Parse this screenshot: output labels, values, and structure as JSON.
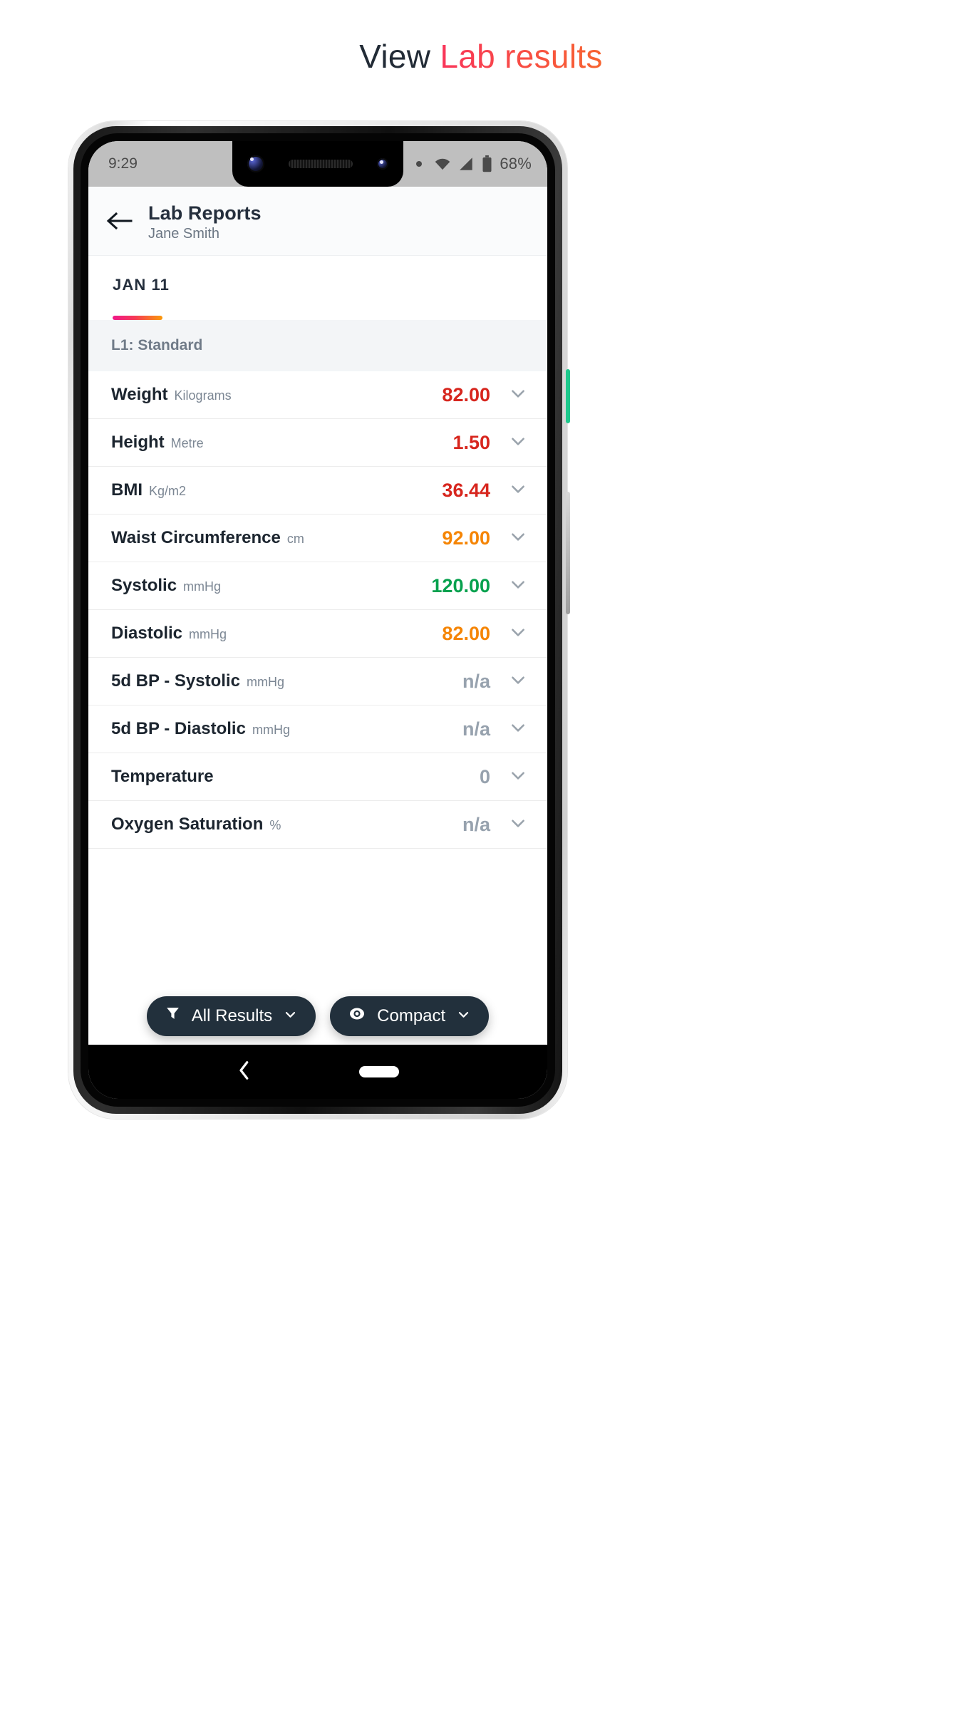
{
  "page": {
    "title_plain": "View ",
    "title_accent": "Lab results",
    "accent_from": "#f9355a",
    "accent_to": "#f7642f"
  },
  "status_bar": {
    "time": "9:29",
    "battery": "68%",
    "icons": [
      "dot-indicator-icon",
      "wifi-icon",
      "cell-signal-icon",
      "battery-icon"
    ]
  },
  "app_bar": {
    "back_icon": "back-arrow-icon",
    "title": "Lab Reports",
    "subtitle": "Jane Smith"
  },
  "tabs": [
    {
      "label": "JAN 11",
      "selected": true
    }
  ],
  "section": {
    "header": "L1: Standard"
  },
  "rows": [
    {
      "name": "Weight",
      "unit": "Kilograms",
      "value": "82.00",
      "color": "#d7261e"
    },
    {
      "name": "Height",
      "unit": "Metre",
      "value": "1.50",
      "color": "#d7261e"
    },
    {
      "name": "BMI",
      "unit": "Kg/m2",
      "value": "36.44",
      "color": "#d7261e"
    },
    {
      "name": "Waist Circumference",
      "unit": "cm",
      "value": "92.00",
      "color": "#f58505"
    },
    {
      "name": "Systolic",
      "unit": "mmHg",
      "value": "120.00",
      "color": "#06a14e"
    },
    {
      "name": "Diastolic",
      "unit": "mmHg",
      "value": "82.00",
      "color": "#f58505"
    },
    {
      "name": "5d BP - Systolic",
      "unit": "mmHg",
      "value": "n/a",
      "color": "#97a2ae"
    },
    {
      "name": "5d BP - Diastolic",
      "unit": "mmHg",
      "value": "n/a",
      "color": "#97a2ae"
    },
    {
      "name": "Temperature",
      "unit": "",
      "value": "0",
      "color": "#97a2ae"
    },
    {
      "name": "Oxygen Saturation",
      "unit": "%",
      "value": "n/a",
      "color": "#97a2ae"
    }
  ],
  "fabs": [
    {
      "icon": "filter-funnel-icon",
      "label": "All Results",
      "chevron": "chevron-down-icon"
    },
    {
      "icon": "eye-icon",
      "label": "Compact",
      "chevron": "chevron-down-icon"
    }
  ],
  "nav_bar": {
    "back_icon": "nav-back-icon",
    "home_pill": "nav-home-pill"
  }
}
